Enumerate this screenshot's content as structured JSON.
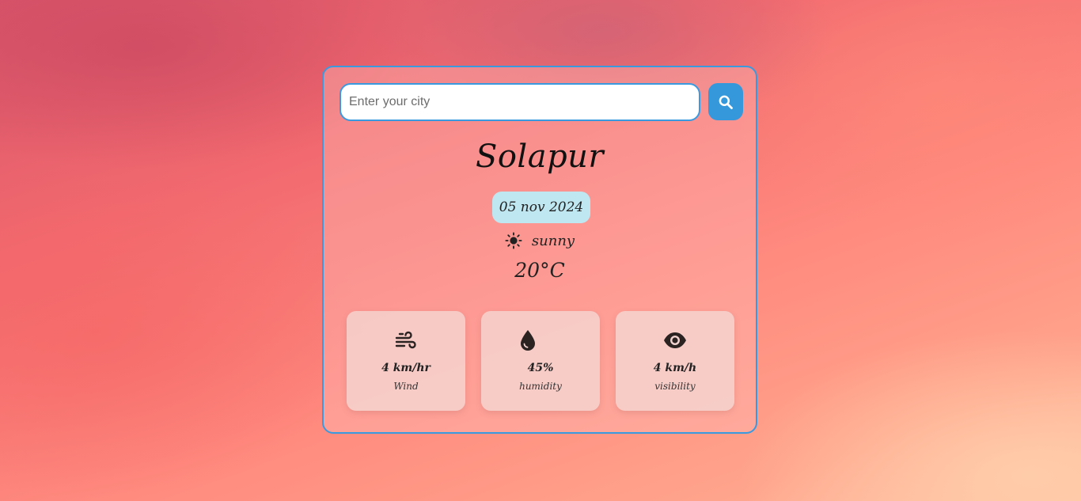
{
  "search": {
    "placeholder": "Enter your city",
    "value": "",
    "button_icon": "search-icon"
  },
  "weather": {
    "city": "Solapur",
    "date": "05 nov 2024",
    "condition": "sunny",
    "condition_icon": "sun-icon",
    "temperature": "20°C"
  },
  "details": [
    {
      "icon": "wind-icon",
      "value": "4 km/hr",
      "label": "Wind"
    },
    {
      "icon": "droplet-icon",
      "value": "45%",
      "label": "humidity"
    },
    {
      "icon": "eye-icon",
      "value": "4 km/h",
      "label": "visibility"
    }
  ],
  "colors": {
    "accent": "#3498db",
    "date_pill": "#bfe7f2"
  }
}
